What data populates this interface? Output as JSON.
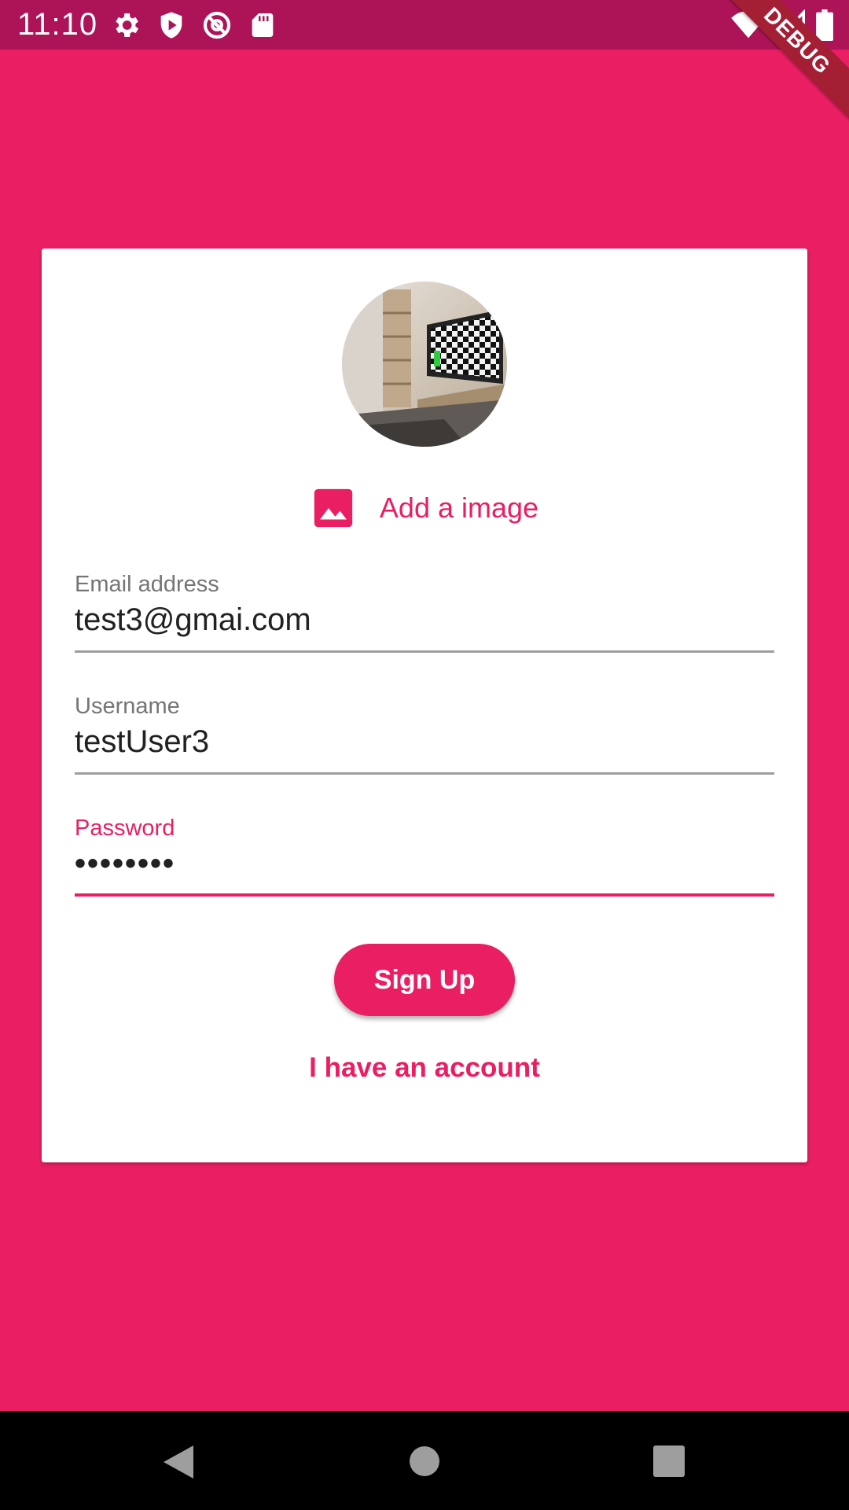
{
  "status_bar": {
    "time": "11:10",
    "left_icons": [
      "gear-icon",
      "shield-play-icon",
      "at-sign-icon",
      "sd-card-icon"
    ],
    "right_icons": [
      "wifi-icon",
      "signal-icon",
      "battery-icon"
    ],
    "debug_banner": "DEBUG"
  },
  "colors": {
    "primary": "#E91E63",
    "status_bar": "#AD1457",
    "card": "#FFFFFF",
    "nav_bar": "#000000"
  },
  "form": {
    "add_image_label": "Add a image",
    "email": {
      "label": "Email address",
      "value": "test3@gmai.com"
    },
    "username": {
      "label": "Username",
      "value": "testUser3"
    },
    "password": {
      "label": "Password",
      "value": "••••••••"
    },
    "signup_label": "Sign Up",
    "have_account_label": "I have an account"
  },
  "nav_bar": {
    "buttons": [
      "back-icon",
      "home-icon",
      "recents-icon"
    ]
  }
}
